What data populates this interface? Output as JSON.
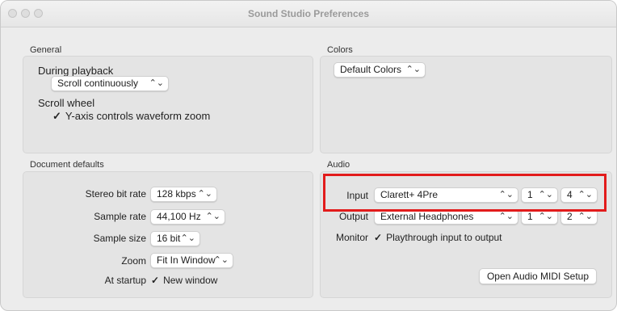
{
  "window": {
    "title": "Sound Studio Preferences"
  },
  "general": {
    "label": "General",
    "during_playback_label": "During playback",
    "during_playback_value": "Scroll continuously",
    "scroll_wheel_label": "Scroll wheel",
    "yaxis_check": {
      "mark": "✓",
      "label": "Y-axis controls waveform zoom"
    }
  },
  "colors": {
    "label": "Colors",
    "value": "Default Colors"
  },
  "document": {
    "label": "Document defaults",
    "stereo_bit_rate_label": "Stereo bit rate",
    "stereo_bit_rate_value": "128 kbps",
    "sample_rate_label": "Sample rate",
    "sample_rate_value": "44,100 Hz",
    "sample_size_label": "Sample size",
    "sample_size_value": "16 bit",
    "zoom_label": "Zoom",
    "zoom_value": "Fit In Window",
    "at_startup_label": "At startup",
    "new_window_check": {
      "mark": "✓",
      "label": "New window"
    }
  },
  "audio": {
    "label": "Audio",
    "input_label": "Input",
    "input_device": "Clarett+ 4Pre",
    "input_ch1": "1",
    "input_ch2": "4",
    "output_label": "Output",
    "output_device": "External Headphones",
    "output_ch1": "1",
    "output_ch2": "2",
    "monitor_label": "Monitor",
    "playthrough_check": {
      "mark": "✓",
      "label": "Playthrough input to output"
    },
    "midi_button": "Open Audio MIDI Setup"
  },
  "icons": {
    "popup_chevron": "chevron-updown-icon",
    "checkmark": "checkmark-icon"
  },
  "colors_used": {
    "highlight": "#e21b1b"
  }
}
